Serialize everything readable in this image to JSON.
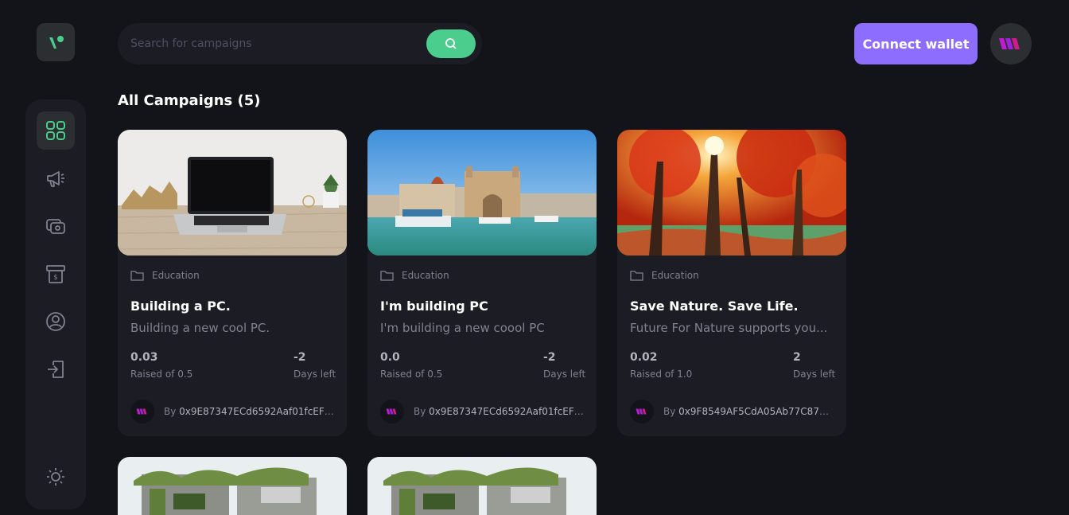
{
  "search": {
    "placeholder": "Search for campaigns"
  },
  "header": {
    "connect_label": "Connect wallet"
  },
  "main": {
    "heading": "All Campaigns (5)"
  },
  "colors": {
    "background": "#13131a",
    "card": "#1c1c24",
    "accent_green": "#4acd8d",
    "accent_purple": "#8c6dfd"
  },
  "sidebar": {
    "items": [
      {
        "icon": "dashboard-icon",
        "active": true
      },
      {
        "icon": "campaign-icon",
        "active": false
      },
      {
        "icon": "payment-icon",
        "active": false
      },
      {
        "icon": "withdraw-icon",
        "active": false
      },
      {
        "icon": "profile-icon",
        "active": false
      },
      {
        "icon": "logout-icon",
        "active": false
      },
      {
        "icon": "sun-icon",
        "active": false
      }
    ]
  },
  "campaigns": [
    {
      "category": "Education",
      "title": "Building a PC.",
      "description": "Building a new cool PC.",
      "raised": "0.03",
      "raised_label": "Raised of 0.5",
      "days": "-2",
      "days_label": "Days left",
      "by": "By",
      "owner": "0x9E87347ECd6592Aaf01fcEF505..."
    },
    {
      "category": "Education",
      "title": "I'm building PC",
      "description": "I'm building a new coool PC",
      "raised": "0.0",
      "raised_label": "Raised of 0.5",
      "days": "-2",
      "days_label": "Days left",
      "by": "By",
      "owner": "0x9E87347ECd6592Aaf01fcEF505..."
    },
    {
      "category": "Education",
      "title": "Save Nature. Save Life.",
      "description": "Future For Nature supports you...",
      "raised": "0.02",
      "raised_label": "Raised of 1.0",
      "days": "2",
      "days_label": "Days left",
      "by": "By",
      "owner": "0x9F8549AF5CdA05Ab77C8792d9..."
    }
  ]
}
